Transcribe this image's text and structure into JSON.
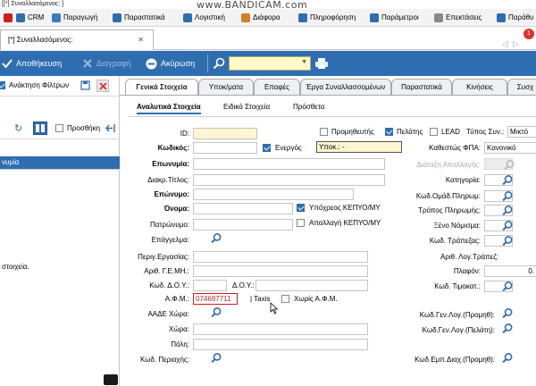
{
  "window": {
    "title": "[[*] Συναλλασόμενος: ]",
    "watermark": "www.BANDICAM.com"
  },
  "menu": [
    {
      "label": "",
      "color": "#cc2020"
    },
    {
      "label": "CRM",
      "color": "#2f6db1"
    },
    {
      "label": "Παραγωγή",
      "color": "#3a7ac0"
    },
    {
      "label": "Παραστατικά",
      "color": "#2f6db1"
    },
    {
      "label": "Λογιστική",
      "color": "#2f6db1"
    },
    {
      "label": "Διάφορα",
      "color": "#d08020"
    },
    {
      "label": "Πληροφόρηση",
      "color": "#2f6db1"
    },
    {
      "label": "Παράμετροι",
      "color": "#2f6db1"
    },
    {
      "label": "Επεκτάσεις",
      "color": "#888888"
    },
    {
      "label": "Παράθυ",
      "color": "#2f6db1"
    }
  ],
  "doc_tab": {
    "label": "[*] Συναλλασόμενος:",
    "close": "✕",
    "badge": "1"
  },
  "toolbar": {
    "save": "Αποθήκευση",
    "delete": "Διαγραφή",
    "cancel": "Ακύρωση"
  },
  "left": {
    "filters": "Ανάκτηση Φίλτρων",
    "add": "Προσθήκη",
    "selected_item": "νυμία",
    "message": "στοιχεία."
  },
  "tabs": [
    "Γενικά Στοιχεία",
    "Υποκ/ματα",
    "Επαφές",
    "Έργα Συναλλασσομένων",
    "Παραστατικά",
    "Κινήσεις",
    "Συσχ"
  ],
  "inner_tabs": [
    "Αναλυτικά Στοιχεία",
    "Ειδικά Στοιχεία",
    "Πρόσθετα"
  ],
  "form": {
    "id_label": "ID:",
    "code_label": "Κωδικός:",
    "name_label": "Επωνυμία:",
    "title_label": "Διακρ.Τίτλος:",
    "surname_label": "Επώνυμο:",
    "firstname_label": "Όνομα:",
    "father_label": "Πατρώνυμο:",
    "profession_label": "Επάγγελμα:",
    "work_label": "Περιγ.Εργασίας:",
    "gemi_label": "Αριθ. Γ.Ε.ΜΗ.:",
    "doy_code_label": "Κωδ. Δ.Ο.Υ.:",
    "doy_label": "Δ.Ο.Υ.:",
    "afm_label": "Α.Φ.Μ.:",
    "afm_value": "074697711",
    "taxis": "| Taxis",
    "no_afm": "Χωρίς Α.Φ.Μ.",
    "aade_label": "ΑΑΔΕ Χώρα:",
    "country_label": "Χώρα:",
    "city_label": "Πόλη:",
    "area_label": "Κωδ. Περιοχής:",
    "supplier": "Προμηθευτής",
    "customer": "Πελάτης",
    "lead": "LEAD",
    "type_label": "Τύπος Συν.:",
    "type_value": "Μικτό",
    "active": "Ενεργός",
    "branch_label": "Υποκ.: -",
    "vat_label": "Καθεστώς ΦΠΑ:",
    "vat_value": "Κανονικό",
    "exempt_label": "Διάταξη Απαλλαγής:",
    "category_label": "Κατηγορία:",
    "payment_group_label": "Κωδ.Ομάδ.Πληρωμ:",
    "payment_method_label": "Τρόπος Πληρωμής:",
    "currency_label": "Ξένο Νόμισμα:",
    "bank_label": "Κωδ. Τράπεζας:",
    "bank_acc_label": "Αριθ. Λογ.Τράπεζ:",
    "ceiling_label": "Πλαφόν:",
    "ceiling_value": "0.",
    "price_label": "Κωδ. Τιμοκατ.:",
    "kepyo_subject": "Υπόχρεος ΚΕΠΥΟ/ΜΥ",
    "kepyo_exempt": "Απαλλαγή ΚΕΠΥΟ/ΜΥ",
    "gl_supplier_label": "Κωδ.Γεν.Λογ.(Προμηθ):",
    "gl_customer_label": "Κωδ.Γεν.Λογ.(Πελάτη):",
    "gl_trade_label": "Κωδ.Εμπ.Διαχ.(Προμηθ):"
  }
}
